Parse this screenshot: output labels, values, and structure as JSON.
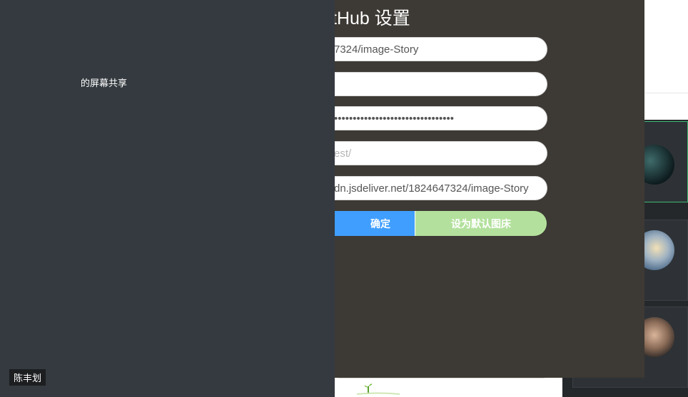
{
  "modal": {
    "title": "tHub 设置",
    "fields": {
      "repo_value": "7324/image-Story",
      "branch_value": "",
      "token_value": "••••••••••••••••••••••••••••••••",
      "path_placeholder": "est/",
      "cdn_value": "dn.jsdeliver.net/1824647324/image-Story"
    },
    "buttons": {
      "confirm_label": "确定",
      "set_default_label": "设为默认图床"
    }
  },
  "video_call": {
    "tile_1_name": "的屏幕共享",
    "tile_3_name": "陈丰划"
  },
  "colors": {
    "modal_bg": "#3d3934",
    "confirm_button": "#409eff",
    "default_button": "#b3e19d",
    "left_panel": "#343a3f"
  }
}
